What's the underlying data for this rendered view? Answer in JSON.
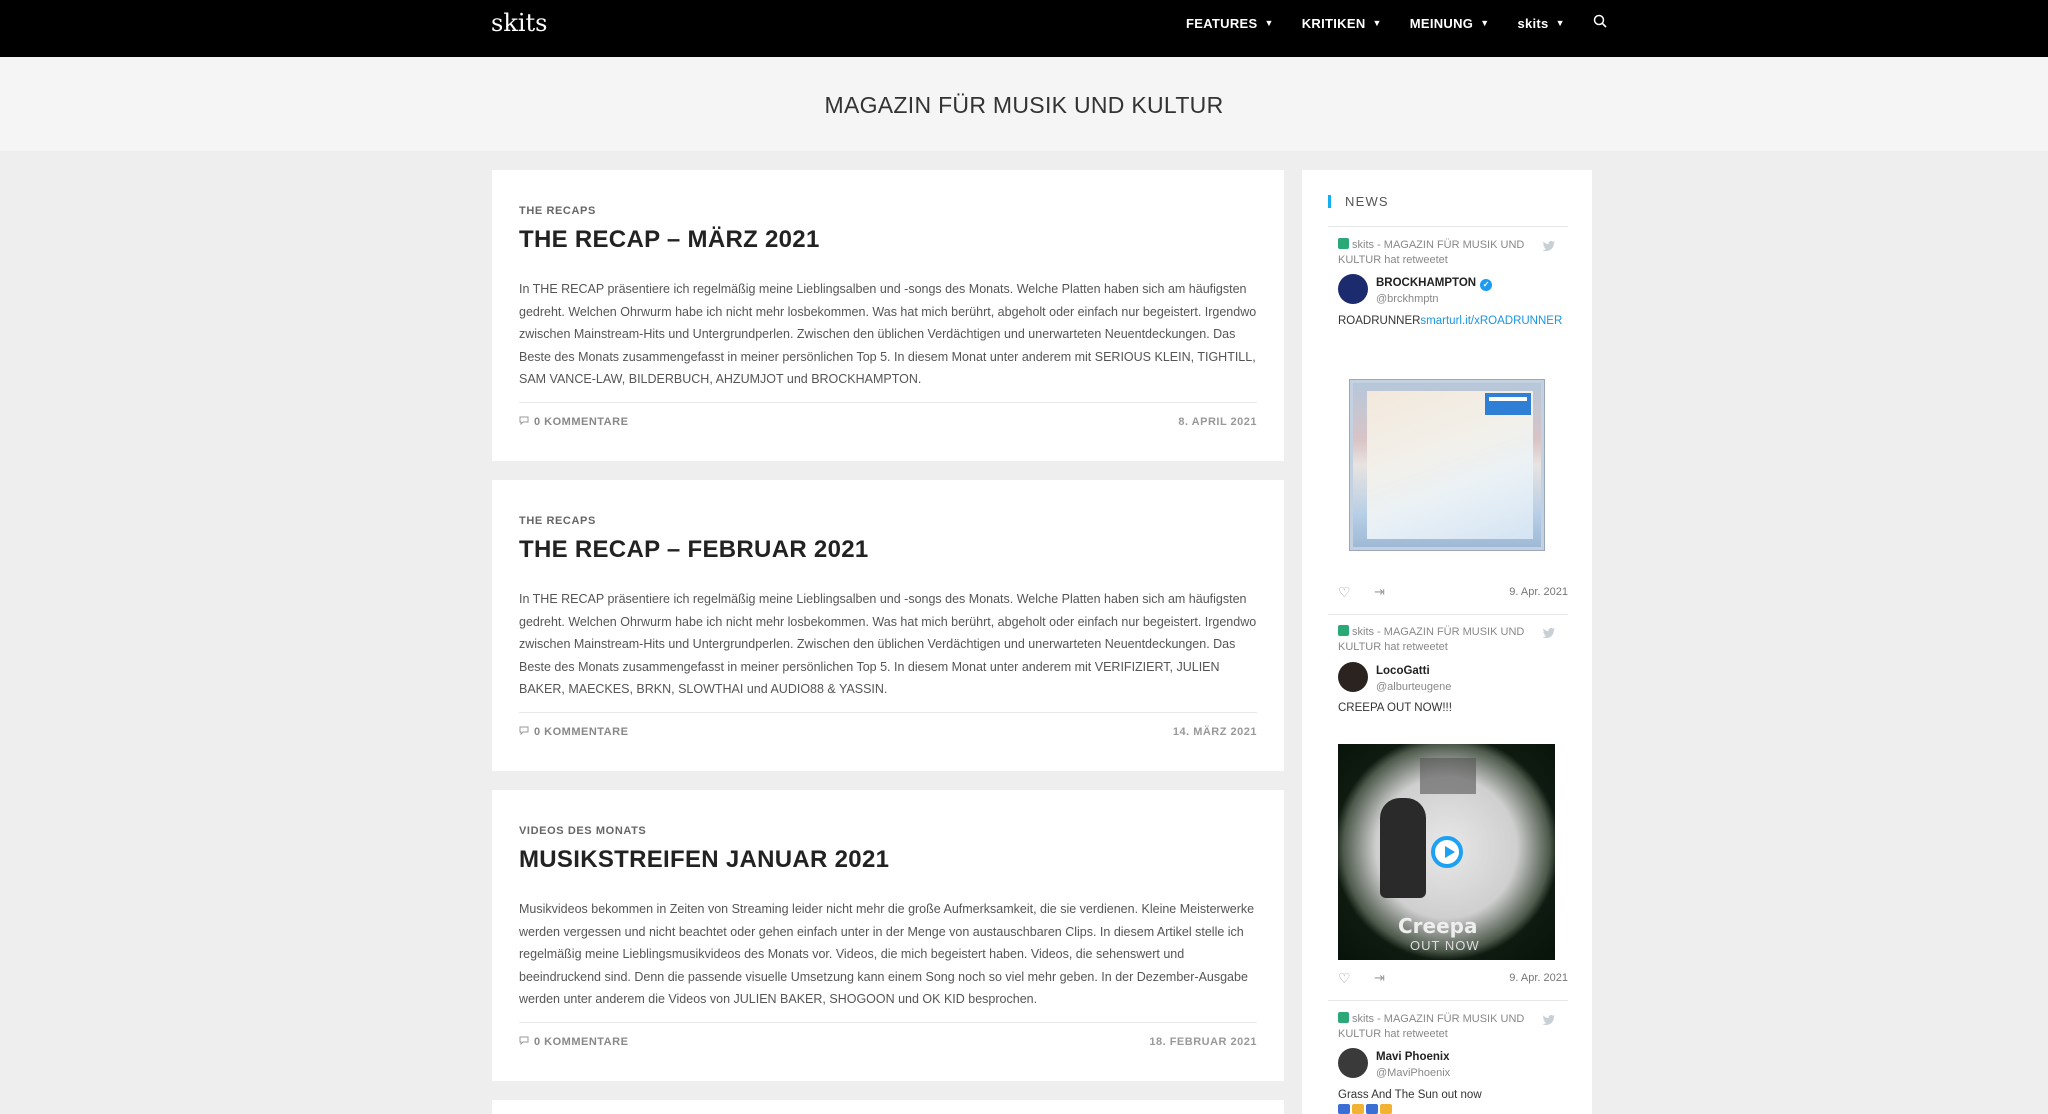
{
  "header": {
    "logo": "skits",
    "nav": [
      {
        "label": "FEATURES"
      },
      {
        "label": "KRITIKEN"
      },
      {
        "label": "MEINUNG"
      },
      {
        "label": "skits"
      }
    ]
  },
  "page": {
    "title": "MAGAZIN FÜR MUSIK UND KULTUR"
  },
  "articles": [
    {
      "category": "THE RECAPS",
      "title": "THE RECAP – MÄRZ 2021",
      "excerpt": "In THE RECAP präsentiere ich regelmäßig meine Lieblingsalben und -songs des Monats. Welche Platten haben sich am häufigsten gedreht. Welchen Ohrwurm habe ich nicht mehr losbekommen. Was hat mich berührt, abgeholt oder einfach nur begeistert. Irgendwo zwischen Mainstream-Hits und Untergrundperlen. Zwischen den üblichen Verdächtigen und unerwarteten Neuentdeckungen. Das Beste des Monats zusammengefasst in meiner persönlichen Top 5. In diesem Monat unter anderem mit SERIOUS KLEIN, TIGHTILL, SAM VANCE-LAW, BILDERBUCH, AHZUMJOT und BROCKHAMPTON.",
      "comments": "0 KOMMENTARE",
      "date": "8. APRIL 2021"
    },
    {
      "category": "THE RECAPS",
      "title": "THE RECAP – FEBRUAR 2021",
      "excerpt": "In THE RECAP präsentiere ich regelmäßig meine Lieblingsalben und -songs des Monats. Welche Platten haben sich am häufigsten gedreht. Welchen Ohrwurm habe ich nicht mehr losbekommen. Was hat mich berührt, abgeholt oder einfach nur begeistert. Irgendwo zwischen Mainstream-Hits und Untergrundperlen. Zwischen den üblichen Verdächtigen und unerwarteten Neuentdeckungen. Das Beste des Monats zusammengefasst in meiner persönlichen Top 5. In diesem Monat unter anderem mit VERIFIZIERT, JULIEN BAKER, MAECKES, BRKN, SLOWTHAI und AUDIO88 & YASSIN.",
      "comments": "0 KOMMENTARE",
      "date": "14. MÄRZ 2021"
    },
    {
      "category": "VIDEOS DES MONATS",
      "title": "MUSIKSTREIFEN JANUAR 2021",
      "excerpt": "Musikvideos bekommen in Zeiten von Streaming leider nicht mehr die große Aufmerksamkeit, die sie verdienen. Kleine Meisterwerke werden vergessen und nicht beachtet oder gehen einfach unter in der Menge von austauschbaren Clips. In diesem Artikel stelle ich regelmäßig meine Lieblingsmusikvideos des Monats vor. Videos, die mich begeistert haben. Videos, die sehenswert und beeindruckend sind. Denn die passende visuelle Umsetzung kann einem Song noch so viel mehr geben. In der Dezember-Ausgabe werden unter anderem die Videos von JULIEN BAKER, SHOGOON und OK KID besprochen.",
      "comments": "0 KOMMENTARE",
      "date": "18. FEBRUAR 2021"
    }
  ],
  "sidebar": {
    "heading": "NEWS",
    "tweets": [
      {
        "retweet": "skits - MAGAZIN FÜR MUSIK UND KULTUR hat retweetet",
        "name": "BROCKHAMPTON",
        "handle": "@brckhmptn",
        "text": "ROADRUNNER",
        "link": "smarturl.it/xROADRUNNER",
        "date": "9. Apr. 2021"
      },
      {
        "retweet": "skits - MAGAZIN FÜR MUSIK UND KULTUR hat retweetet",
        "name": "LocoGatti",
        "handle": "@alburteugene",
        "text": "CREEPA OUT NOW!!!",
        "video_title": "Creepa",
        "video_sub": "OUT NOW",
        "date": "9. Apr. 2021"
      },
      {
        "retweet": "skits - MAGAZIN FÜR MUSIK UND KULTUR hat retweetet",
        "name": "Mavi Phoenix",
        "handle": "@MaviPhoenix",
        "text": "Grass And The Sun out now"
      }
    ]
  },
  "colors": {
    "topbar": "#000000",
    "accent": "#13aff0",
    "link": "#1b95e0"
  }
}
